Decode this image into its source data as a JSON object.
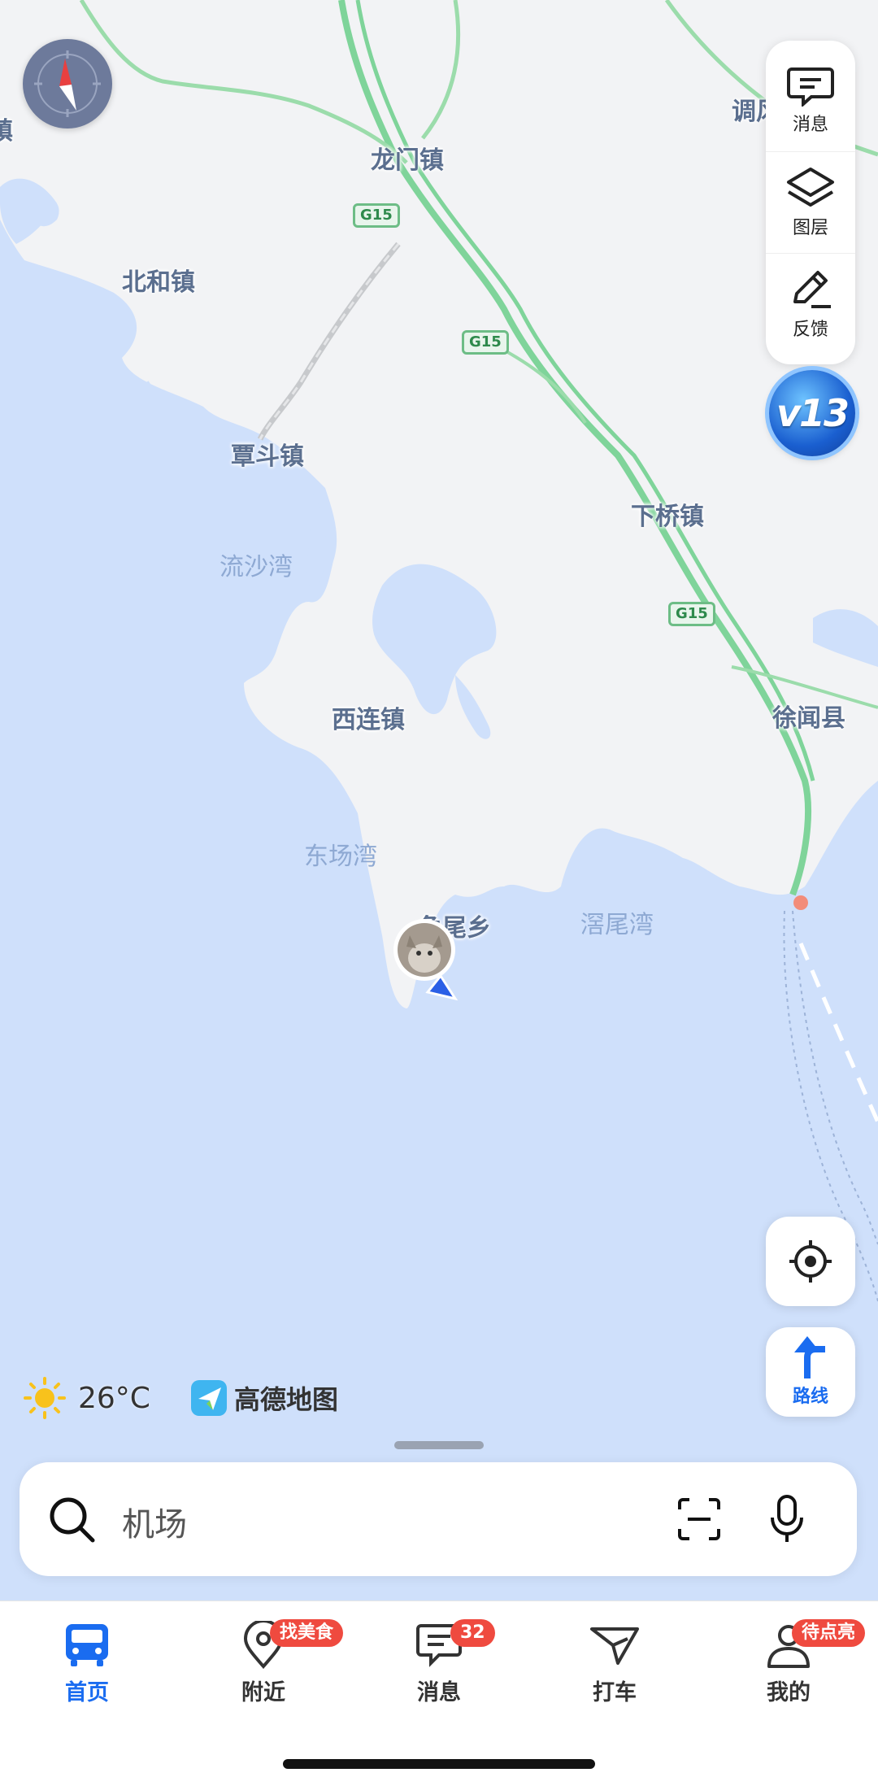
{
  "map": {
    "places": {
      "longmen": "龙门镇",
      "beihe": "北和镇",
      "tandou": "覃斗镇",
      "liushawan": "流沙湾",
      "xiaqiao": "下桥镇",
      "xilian": "西连镇",
      "xuwen": "徐闻县",
      "dongchangwan": "东场湾",
      "jiaoweixiang": "角尾乡",
      "hanweiwan": "滘尾湾",
      "tiaofeng": "调风",
      "edge_left": "镇"
    },
    "highway": "G15"
  },
  "compass": {
    "icon": "compass-icon"
  },
  "right_panel": [
    {
      "label": "消息",
      "icon": "message-icon"
    },
    {
      "label": "图层",
      "icon": "layers-icon"
    },
    {
      "label": "反馈",
      "icon": "edit-feedback-icon"
    }
  ],
  "vip_badge": {
    "text": "v13"
  },
  "locate": {
    "icon": "locate-icon"
  },
  "route": {
    "label": "路线",
    "icon": "route-arrow-icon"
  },
  "weather": {
    "temp": "26°C",
    "icon": "sun-icon"
  },
  "brand": {
    "name": "高德地图",
    "icon": "amap-logo-icon"
  },
  "search": {
    "placeholder": "机场",
    "scan_icon": "scan-icon",
    "mic_icon": "mic-icon"
  },
  "tabs": [
    {
      "label": "首页",
      "icon": "bus-icon",
      "active": true
    },
    {
      "label": "附近",
      "icon": "location-pin-icon",
      "badge": "找美食"
    },
    {
      "label": "消息",
      "icon": "message-icon",
      "badge": "32"
    },
    {
      "label": "打车",
      "icon": "taxi-icon"
    },
    {
      "label": "我的",
      "icon": "user-icon",
      "badge": "待点亮"
    }
  ],
  "colors": {
    "accent": "#1a6cf0",
    "badge": "#ef4a3f",
    "sea": "#cfe0fb",
    "land": "#f2f3f5",
    "highway": "#7fd49a"
  }
}
